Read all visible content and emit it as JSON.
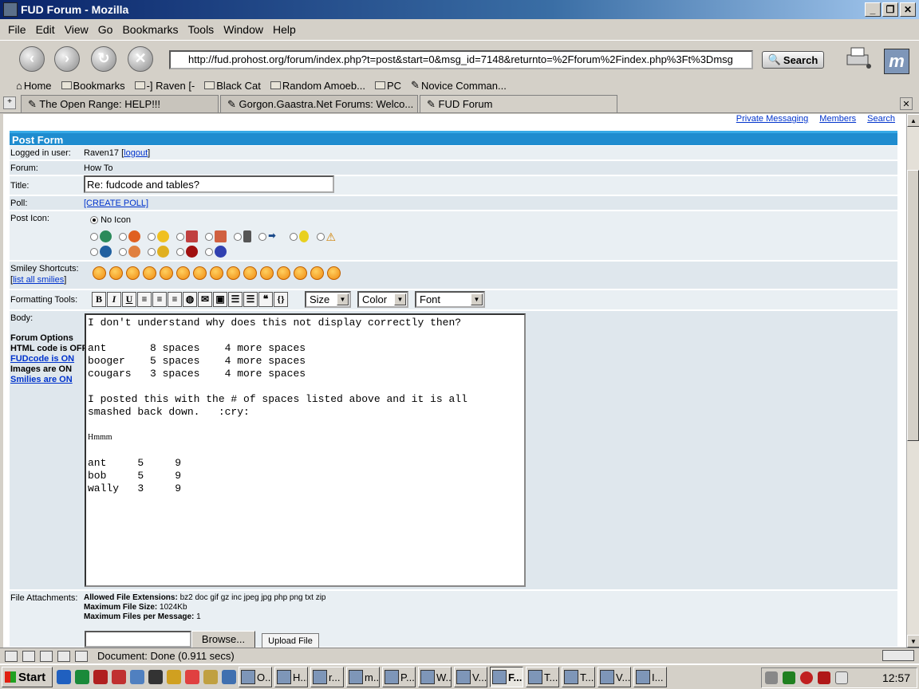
{
  "window": {
    "title": "FUD Forum - Mozilla"
  },
  "menu": [
    "File",
    "Edit",
    "View",
    "Go",
    "Bookmarks",
    "Tools",
    "Window",
    "Help"
  ],
  "nav": {
    "url": "http://fud.prohost.org/forum/index.php?t=post&start=0&msg_id=7148&returnto=%2Fforum%2Findex.php%3Ft%3Dmsg",
    "search_label": "Search"
  },
  "bookmarks": [
    "Home",
    "Bookmarks",
    "-] Raven [-",
    "Black Cat",
    "Random Amoeb...",
    "PC",
    "Novice Comman..."
  ],
  "tabs": [
    "The Open Range: HELP!!!",
    "Gorgon.Gaastra.Net Forums: Welco...",
    "FUD Forum"
  ],
  "top_links": [
    "Private Messaging",
    "Members",
    "Search"
  ],
  "form": {
    "header": "Post Form",
    "logged_in_label": "Logged in user:",
    "logged_in_user": "Raven17",
    "logout": "logout",
    "forum_label": "Forum:",
    "forum_value": "How To",
    "title_label": "Title:",
    "title_value": "Re: fudcode and tables?",
    "poll_label": "Poll:",
    "poll_link": "[CREATE POLL]",
    "post_icon_label": "Post Icon:",
    "no_icon": "No Icon",
    "smiley_label": "Smiley Shortcuts:",
    "list_smilies": "list all smilies",
    "formatting_label": "Formatting Tools:",
    "format_buttons": [
      "B",
      "I",
      "U"
    ],
    "size_select": "Size",
    "color_select": "Color",
    "font_select": "Font",
    "body_label": "Body:",
    "body_text": "I don't understand why does this not display correctly then?\n\nant       8 spaces    4 more spaces\nbooger    5 spaces    4 more spaces\ncougars   3 spaces    4 more spaces\n\nI posted this with the # of spaces listed above and it is all\nsmashed back down.   :cry:",
    "body_hmm": "Hmmm",
    "body_table": "ant     5     9\nbob     5     9\nwally   3     9",
    "forum_options_title": "Forum Options",
    "opt_html": "HTML code is",
    "opt_html_val": "OFF",
    "opt_fud": "FUDcode is ON",
    "opt_images": "Images",
    "opt_images_rest": "are ON",
    "opt_smilies": "Smilies are ON",
    "attach_label": "File Attachments:",
    "allowed_ext_label": "Allowed File Extensions:",
    "allowed_ext": "bz2 doc gif gz inc jpeg jpg php png txt zip",
    "max_size_label": "Maximum File Size:",
    "max_size": "1024Kb",
    "max_files_label": "Maximum Files per Message:",
    "max_files": "1",
    "browse": "Browse...",
    "upload": "Upload File"
  },
  "status": {
    "text": "Document: Done (0.911 secs)"
  },
  "taskbar": {
    "start": "Start",
    "tasks": [
      "O...",
      "H...",
      "r...",
      "m...",
      "P...",
      "W...",
      "V...",
      "F...",
      "T...",
      "T...",
      "V...",
      "I..."
    ],
    "clock": "12:57"
  },
  "colors": {
    "header_bar": "#1f8ccf",
    "title_bar": "#0a246a",
    "link": "#0033cc"
  }
}
